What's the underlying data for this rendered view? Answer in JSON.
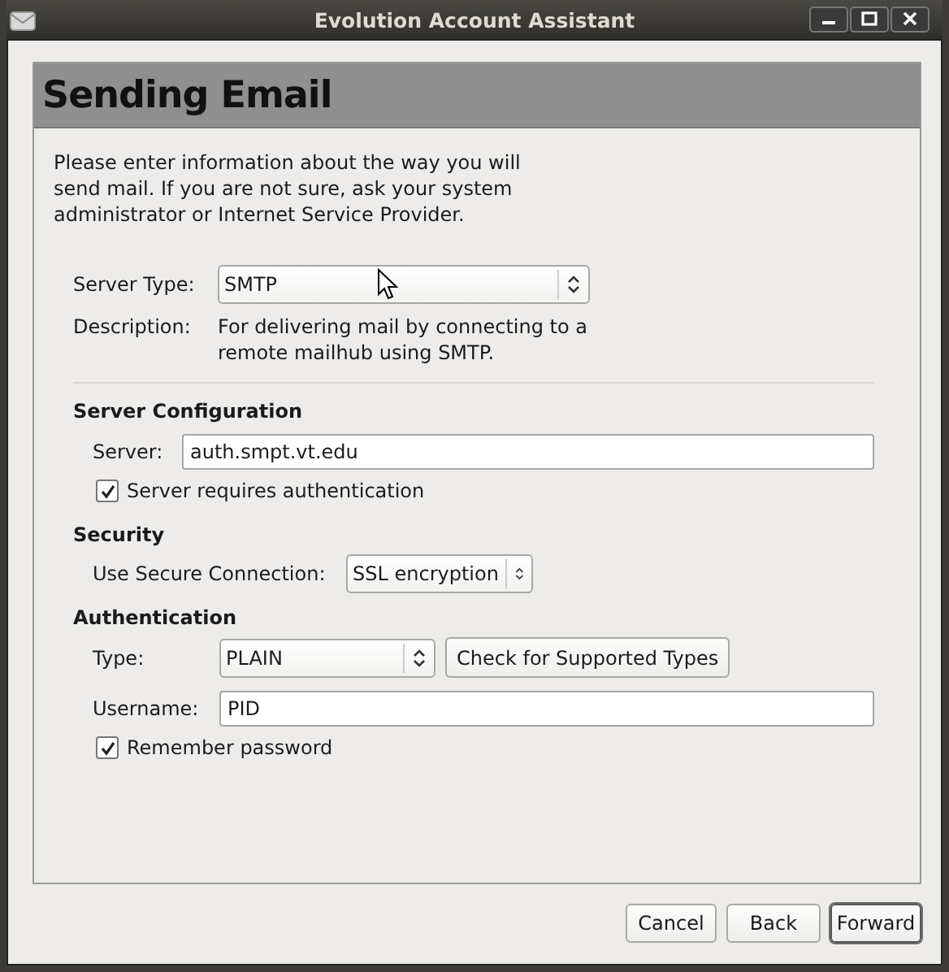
{
  "window": {
    "title": "Evolution Account Assistant"
  },
  "page": {
    "title": "Sending Email",
    "intro": "Please enter information about the way you will send mail. If you are not sure, ask your system administrator or Internet Service Provider."
  },
  "server_type": {
    "label": "Server Type:",
    "value": "SMTP"
  },
  "description": {
    "label": "Description:",
    "text": "For delivering mail by connecting to a remote mailhub using SMTP."
  },
  "server_configuration": {
    "heading": "Server Configuration",
    "server": {
      "label": "Server:",
      "value": "auth.smpt.vt.edu"
    },
    "requires_auth": {
      "label": "Server requires authentication",
      "checked": true
    }
  },
  "security": {
    "heading": "Security",
    "secure_connection": {
      "label": "Use Secure Connection:",
      "value": "SSL encryption"
    }
  },
  "authentication": {
    "heading": "Authentication",
    "type": {
      "label": "Type:",
      "value": "PLAIN"
    },
    "check_button": "Check for Supported Types",
    "username": {
      "label": "Username:",
      "value": "PID"
    },
    "remember_password": {
      "label": "Remember password",
      "checked": true
    }
  },
  "buttons": [
    {
      "label": "Cancel",
      "default": false
    },
    {
      "label": "Back",
      "default": false
    },
    {
      "label": "Forward",
      "default": true
    }
  ]
}
